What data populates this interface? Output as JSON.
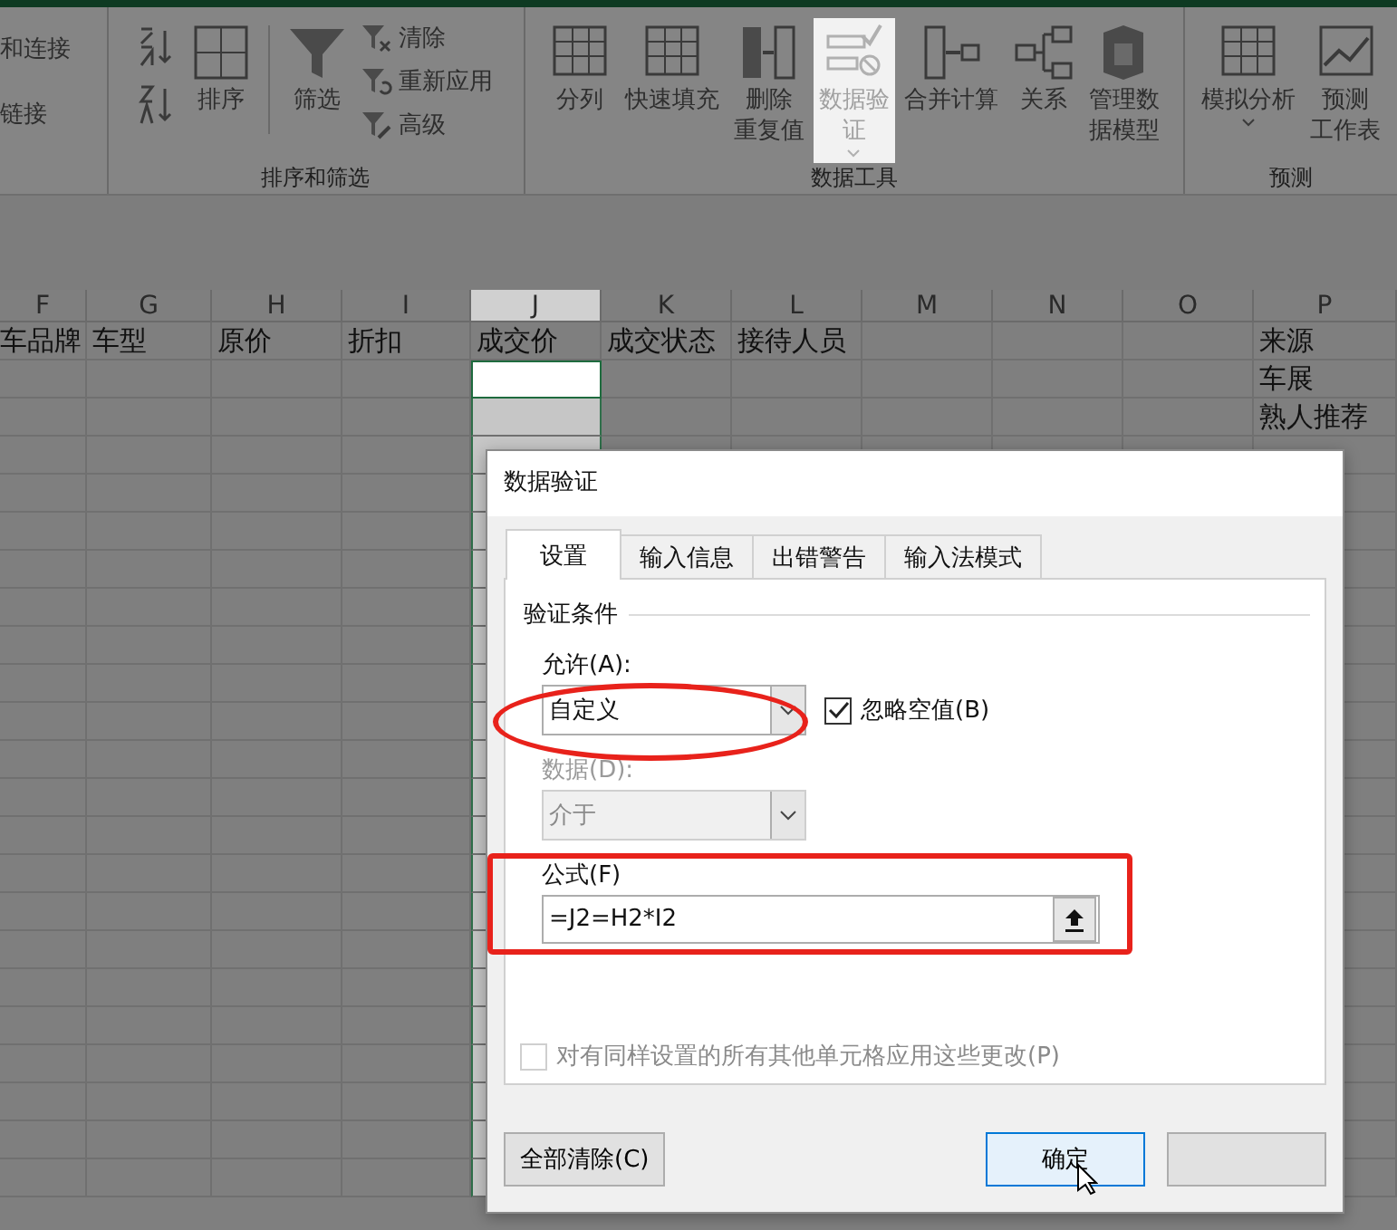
{
  "ribbon": {
    "groups": [
      {
        "kind": "partial",
        "items": [
          {
            "kind": "text",
            "label": "和连接"
          },
          {
            "kind": "text",
            "label": "链接"
          }
        ]
      },
      {
        "kind": "sort",
        "label": "排序和筛选",
        "items": [
          {
            "kind": "small-icons"
          },
          {
            "kind": "big",
            "label": [
              "排序"
            ]
          },
          {
            "kind": "sep"
          },
          {
            "kind": "big",
            "label": [
              "筛选"
            ]
          },
          {
            "kind": "small-list",
            "entries": [
              {
                "label": "清除"
              },
              {
                "label": "重新应用"
              },
              {
                "label": "高级"
              }
            ]
          }
        ]
      },
      {
        "kind": "tools",
        "label": "数据工具",
        "items": [
          {
            "kind": "big",
            "label": [
              "分列"
            ],
            "selected": false
          },
          {
            "kind": "big",
            "label": [
              "快速填充"
            ],
            "selected": false
          },
          {
            "kind": "big",
            "label": [
              "删除",
              "重复值"
            ],
            "selected": false
          },
          {
            "kind": "big",
            "label": [
              "数据验",
              "证"
            ],
            "caret": true,
            "selected": true
          },
          {
            "kind": "big",
            "label": [
              "合并计算"
            ],
            "selected": false
          },
          {
            "kind": "big",
            "label": [
              "关系"
            ],
            "selected": false
          },
          {
            "kind": "big",
            "label": [
              "管理数",
              "据模型"
            ],
            "selected": false
          }
        ]
      },
      {
        "kind": "forecast",
        "label": "预测",
        "items": [
          {
            "kind": "big",
            "label": [
              "模拟分析"
            ],
            "caret": true,
            "selected": false
          },
          {
            "kind": "big",
            "label": [
              "预测",
              "工作表"
            ],
            "selected": false
          }
        ]
      }
    ]
  },
  "sheet": {
    "columns": [
      {
        "letter": "F",
        "selected": false,
        "cells": [
          "车品牌"
        ]
      },
      {
        "letter": "G",
        "selected": false,
        "cells": [
          "车型"
        ]
      },
      {
        "letter": "H",
        "selected": false,
        "cells": [
          "原价"
        ]
      },
      {
        "letter": "I",
        "selected": false,
        "cells": [
          "折扣"
        ]
      },
      {
        "letter": "J",
        "selected": true,
        "cells": [
          "成交价"
        ]
      },
      {
        "letter": "K",
        "selected": false,
        "cells": [
          "成交状态"
        ]
      },
      {
        "letter": "L",
        "selected": false,
        "cells": [
          "接待人员"
        ]
      },
      {
        "letter": "M",
        "selected": false
      },
      {
        "letter": "N",
        "selected": false
      },
      {
        "letter": "O",
        "selected": false
      },
      {
        "letter": "P",
        "selected": false,
        "cells": [
          "来源",
          "车展",
          "熟人推荐"
        ]
      }
    ]
  },
  "dialog": {
    "title": "数据验证",
    "tabs": [
      {
        "label": "设置",
        "selected": true
      },
      {
        "label": "输入信息",
        "selected": false
      },
      {
        "label": "出错警告",
        "selected": false
      },
      {
        "label": "输入法模式",
        "selected": false
      }
    ],
    "section": "验证条件",
    "allow": {
      "label": "允许(A):",
      "value": "自定义",
      "disabled": false
    },
    "ignore_blank": {
      "label": "忽略空值(B)",
      "checked": true
    },
    "data": {
      "label": "数据(D):",
      "value": "介于",
      "disabled": true
    },
    "formula": {
      "label": "公式(F)",
      "value": "=J2=H2*I2"
    },
    "apply_all": {
      "label": "对有同样设置的所有其他单元格应用这些更改(P)",
      "checked": false,
      "disabled": true
    },
    "buttons": [
      {
        "kind": "clear",
        "label": "全部清除(C)"
      },
      {
        "kind": "ok",
        "label": "确定"
      },
      {
        "kind": "cancel"
      }
    ]
  }
}
